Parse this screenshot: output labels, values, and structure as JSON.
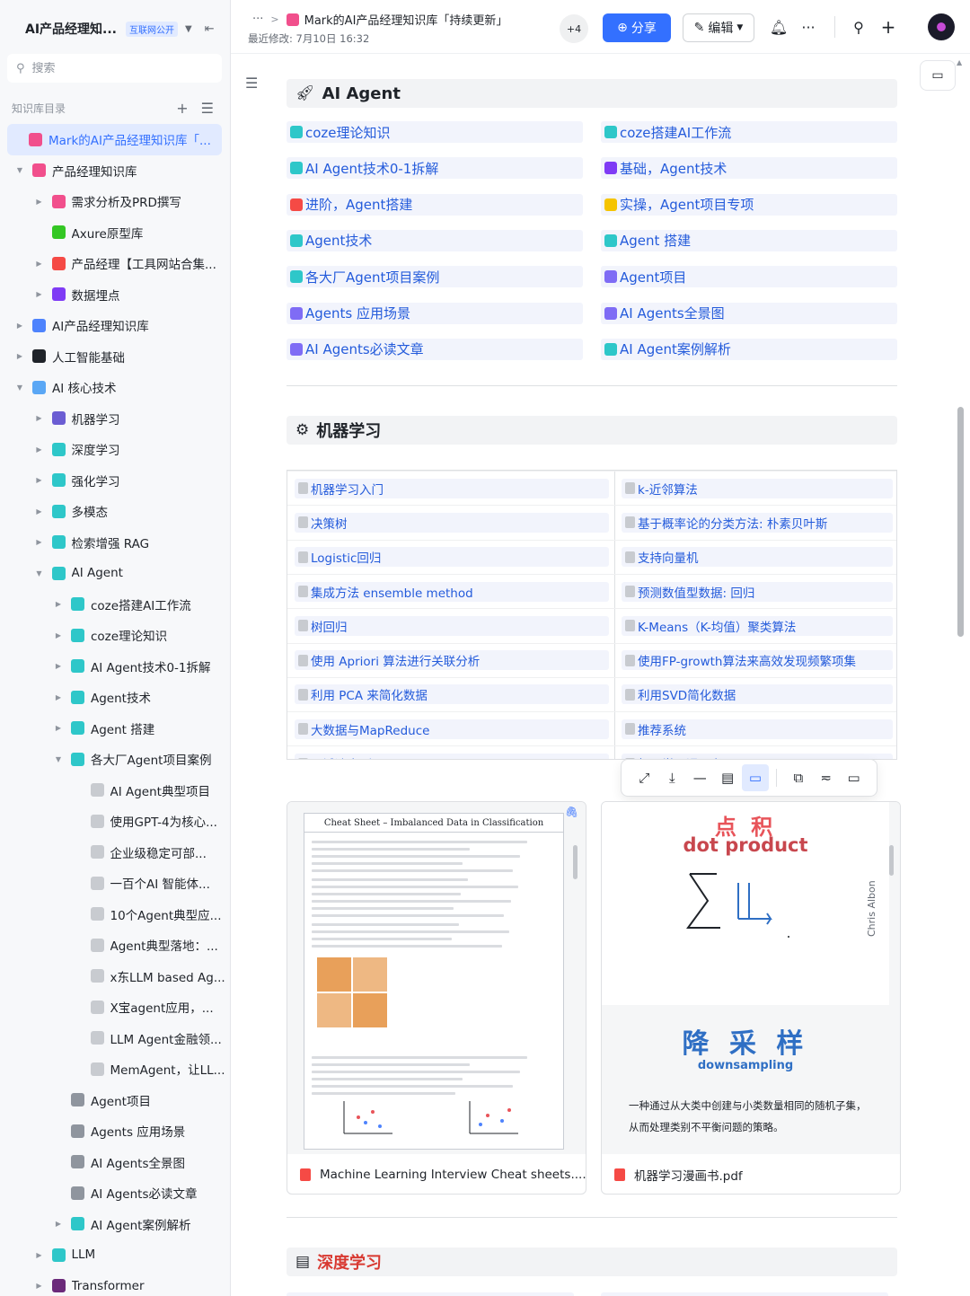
{
  "sidebar": {
    "title": "AI产品经理知...",
    "badge": "互联网公开",
    "search_placeholder": "搜索",
    "dir_label": "知识库目录",
    "items": [
      {
        "label": "Mark的AI产品经理知识库「...",
        "depth": 0,
        "arrow": "",
        "color": "#f14f8c",
        "selected": true
      },
      {
        "label": "产品经理知识库",
        "depth": 0,
        "arrow": "▼",
        "color": "#f14f8c"
      },
      {
        "label": "需求分析及PRD撰写",
        "depth": 1,
        "arrow": "▶",
        "color": "#f14f8c"
      },
      {
        "label": "Axure原型库",
        "depth": 1,
        "arrow": "",
        "color": "#34c724"
      },
      {
        "label": "产品经理【工具网站合集...",
        "depth": 1,
        "arrow": "▶",
        "color": "#f54a45"
      },
      {
        "label": "数据埋点",
        "depth": 1,
        "arrow": "▶",
        "color": "#7f3bf5"
      },
      {
        "label": "AI产品经理知识库",
        "depth": 0,
        "arrow": "▶",
        "color": "#4e83fd"
      },
      {
        "label": "人工智能基础",
        "depth": 0,
        "arrow": "▶",
        "color": "#1f2329"
      },
      {
        "label": "AI 核心技术",
        "depth": 0,
        "arrow": "▼",
        "color": "#5aa7f5"
      },
      {
        "label": "机器学习",
        "depth": 1,
        "arrow": "▶",
        "color": "#6b5dd3"
      },
      {
        "label": "深度学习",
        "depth": 1,
        "arrow": "▶",
        "color": "#2ec7c9"
      },
      {
        "label": "强化学习",
        "depth": 1,
        "arrow": "▶",
        "color": "#2ec7c9"
      },
      {
        "label": "多模态",
        "depth": 1,
        "arrow": "▶",
        "color": "#2ec7c9"
      },
      {
        "label": "检索增强 RAG",
        "depth": 1,
        "arrow": "▶",
        "color": "#2ec7c9"
      },
      {
        "label": "AI Agent",
        "depth": 1,
        "arrow": "▼",
        "color": "#2ec7c9"
      },
      {
        "label": "coze搭建AI工作流",
        "depth": 2,
        "arrow": "▶",
        "color": "#2ec7c9"
      },
      {
        "label": "coze理论知识",
        "depth": 2,
        "arrow": "▶",
        "color": "#2ec7c9"
      },
      {
        "label": "AI Agent技术0-1拆解",
        "depth": 2,
        "arrow": "▶",
        "color": "#2ec7c9"
      },
      {
        "label": "Agent技术",
        "depth": 2,
        "arrow": "▶",
        "color": "#2ec7c9"
      },
      {
        "label": "Agent 搭建",
        "depth": 2,
        "arrow": "▶",
        "color": "#2ec7c9"
      },
      {
        "label": "各大厂Agent项目案例",
        "depth": 2,
        "arrow": "▼",
        "color": "#2ec7c9"
      },
      {
        "label": "AI Agent典型项目",
        "depth": 3,
        "arrow": "",
        "color": "#c8cbd0"
      },
      {
        "label": "使用GPT-4为核心...",
        "depth": 3,
        "arrow": "",
        "color": "#c8cbd0"
      },
      {
        "label": "企业级稳定可部...",
        "depth": 3,
        "arrow": "",
        "color": "#c8cbd0"
      },
      {
        "label": "一百个AI 智能体...",
        "depth": 3,
        "arrow": "",
        "color": "#c8cbd0"
      },
      {
        "label": "10个Agent典型应...",
        "depth": 3,
        "arrow": "",
        "color": "#c8cbd0"
      },
      {
        "label": "Agent典型落地：...",
        "depth": 3,
        "arrow": "",
        "color": "#c8cbd0"
      },
      {
        "label": "x东LLM based Ag...",
        "depth": 3,
        "arrow": "",
        "color": "#c8cbd0"
      },
      {
        "label": "X宝agent应用，...",
        "depth": 3,
        "arrow": "",
        "color": "#c8cbd0"
      },
      {
        "label": "LLM Agent金融领...",
        "depth": 3,
        "arrow": "",
        "color": "#c8cbd0"
      },
      {
        "label": "MemAgent，让LL...",
        "depth": 3,
        "arrow": "",
        "color": "#c8cbd0"
      },
      {
        "label": "Agent项目",
        "depth": 2,
        "arrow": "",
        "color": "#8f959e"
      },
      {
        "label": "Agents 应用场景",
        "depth": 2,
        "arrow": "",
        "color": "#8f959e"
      },
      {
        "label": "AI Agents全景图",
        "depth": 2,
        "arrow": "",
        "color": "#8f959e"
      },
      {
        "label": "AI Agents必读文章",
        "depth": 2,
        "arrow": "",
        "color": "#8f959e"
      },
      {
        "label": "AI Agent案例解析",
        "depth": 2,
        "arrow": "▶",
        "color": "#2ec7c9"
      },
      {
        "label": "LLM",
        "depth": 1,
        "arrow": "▶",
        "color": "#2ec7c9"
      },
      {
        "label": "Transformer",
        "depth": 1,
        "arrow": "▶",
        "color": "#6b2a7a"
      }
    ]
  },
  "header": {
    "breadcrumb_dots": "···",
    "doc_title": "Mark的AI产品经理知识库「持续更新」",
    "last_modified": "最近修改: 7月10日 16:32",
    "collaborators": "+4",
    "share_label": "分享",
    "edit_label": "编辑"
  },
  "sections": {
    "agent_title": "AI  Agent",
    "ml_title": "机器学习",
    "dl_title": "深度学习"
  },
  "agent_links": [
    {
      "label": "coze理论知识",
      "color": "#2ec7c9"
    },
    {
      "label": "coze搭建AI工作流",
      "color": "#2ec7c9"
    },
    {
      "label": "AI Agent技术0-1拆解",
      "color": "#2ec7c9"
    },
    {
      "label": "基础，Agent技术",
      "color": "#7f3bf5"
    },
    {
      "label": "进阶，Agent搭建",
      "color": "#f54a45"
    },
    {
      "label": "实操，Agent项目专项",
      "color": "#f5c400"
    },
    {
      "label": "Agent技术",
      "color": "#2ec7c9"
    },
    {
      "label": "Agent 搭建",
      "color": "#2ec7c9"
    },
    {
      "label": "各大厂Agent项目案例",
      "color": "#2ec7c9"
    },
    {
      "label": "Agent项目",
      "color": "#7f6cf5"
    },
    {
      "label": "Agents 应用场景",
      "color": "#7f6cf5"
    },
    {
      "label": "AI Agents全景图",
      "color": "#7f6cf5"
    },
    {
      "label": "AI Agents必读文章",
      "color": "#7f6cf5"
    },
    {
      "label": "AI Agent案例解析",
      "color": "#2ec7c9"
    }
  ],
  "ml_links": [
    [
      "机器学习入门",
      "k-近邻算法"
    ],
    [
      "决策树",
      "基于概率论的分类方法: 朴素贝叶斯"
    ],
    [
      "Logistic回归",
      "支持向量机"
    ],
    [
      "集成方法 ensemble method",
      "预测数值型数据: 回归"
    ],
    [
      "树回归",
      "K-Means（K-均值）聚类算法"
    ],
    [
      "使用 Apriori 算法进行关联分析",
      "使用FP-growth算法来高效发现频繁项集"
    ],
    [
      "利用 PCA 来简化数据",
      "利用SVD简化数据"
    ],
    [
      "大数据与MapReduce",
      "推荐系统"
    ],
    [
      "面试速查（cheat sheets)",
      "机器学习漫画书.pdf"
    ]
  ],
  "files": [
    {
      "name": "Machine Learning Interview Cheat sheets....",
      "sheet_title": "Cheat Sheet – Imbalanced Data in Classification"
    },
    {
      "name": "机器学习漫画书.pdf",
      "top_cn": "点 积",
      "top_en": "dot product",
      "bot_cn": "降 采 样",
      "bot_en": "downsampling",
      "note": "一种通过从大类中创建与小类数量相同的随机子集，从而处理类别不平衡问题的策略。",
      "signature": "Chris Albon"
    }
  ]
}
